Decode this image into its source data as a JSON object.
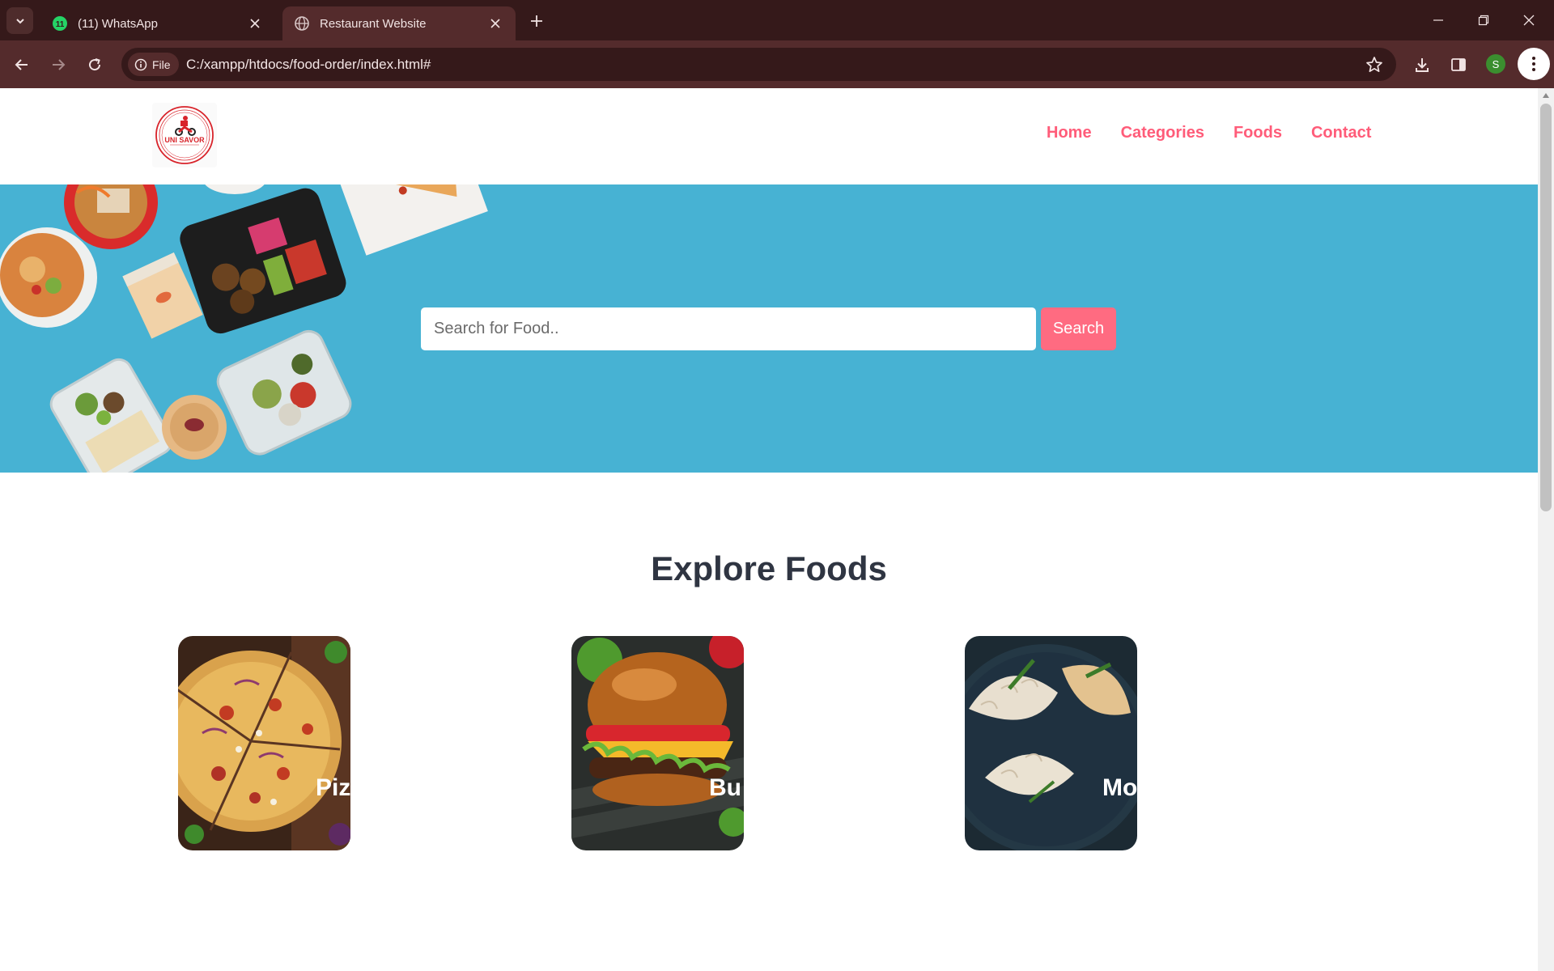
{
  "browser": {
    "tabs": [
      {
        "title": "(11) WhatsApp",
        "badge": "11",
        "active": false
      },
      {
        "title": "Restaurant Website",
        "active": true
      }
    ],
    "address": {
      "chip_label": "File",
      "url": "C:/xampp/htdocs/food-order/index.html#"
    },
    "profile_initial": "S"
  },
  "site": {
    "logo_text": "UNI SAVOR",
    "nav": [
      "Home",
      "Categories",
      "Foods",
      "Contact"
    ],
    "search": {
      "placeholder": "Search for Food..",
      "button_label": "Search"
    },
    "section_title": "Explore Foods",
    "categories": [
      {
        "label": "Piz",
        "icon": "pizza-photo"
      },
      {
        "label": "Bu",
        "icon": "burger-photo"
      },
      {
        "label": "Mo",
        "icon": "momo-photo"
      }
    ]
  },
  "colors": {
    "accent": "#ff6b81",
    "nav_link": "#ff5c79",
    "hero_bg": "#47b2d3",
    "heading": "#2f3542",
    "browser_frame": "#35191a",
    "browser_toolbar": "#542b2c"
  }
}
